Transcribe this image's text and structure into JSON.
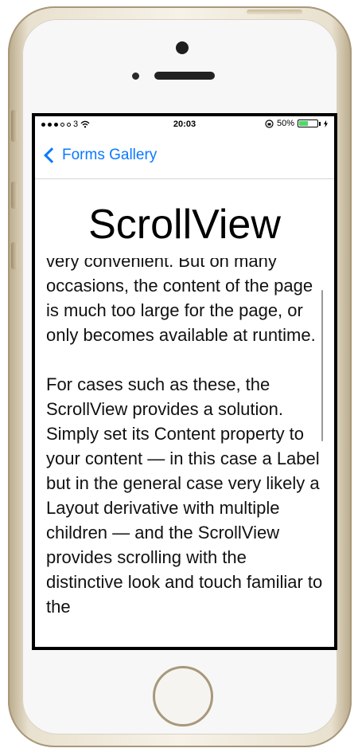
{
  "status_bar": {
    "carrier": "3",
    "time": "20:03",
    "battery_percent": "50%",
    "battery_level": 0.5,
    "battery_color": "#4cd964"
  },
  "nav": {
    "back_label": "Forms Gallery",
    "accent_color": "#0a7aff"
  },
  "page": {
    "title": "ScrollView",
    "paragraphs": [
      "very convenient. But on many occasions, the content of the page is much too large for the page, or only becomes available at runtime.",
      "For cases such as these, the ScrollView provides a solution. Simply set its Content property to your content — in this case a Label but in the general case very likely a Layout derivative with multiple children — and the ScrollView provides scrolling with the distinctive look and touch familiar to the"
    ]
  },
  "icons": {
    "back": "chevron-left-icon",
    "wifi": "wifi-icon",
    "orientation_lock": "orientation-lock-icon",
    "battery": "battery-icon",
    "charging": "charging-icon"
  }
}
